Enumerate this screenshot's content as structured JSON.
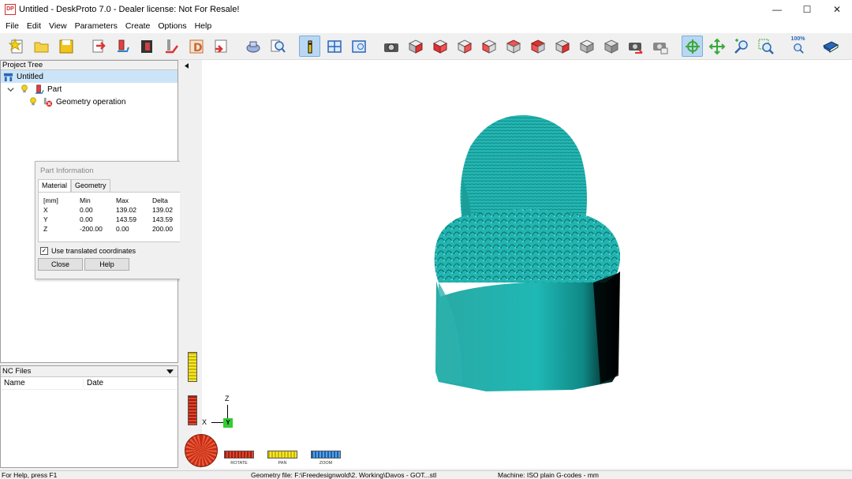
{
  "window": {
    "app_icon_text": "DP",
    "title": "Untitled - DeskProto 7.0 - Dealer license: Not For Resale!",
    "minimize": "—",
    "maximize": "☐",
    "close": "✕"
  },
  "menu": [
    "File",
    "Edit",
    "View",
    "Parameters",
    "Create",
    "Options",
    "Help"
  ],
  "toolbar": {
    "zoom_label": "100%"
  },
  "project_tree": {
    "header": "Project Tree",
    "root": "Untitled",
    "part": "Part",
    "operation": "Geometry operation"
  },
  "nc_files": {
    "header": "NC Files",
    "columns": [
      "Name",
      "Date"
    ]
  },
  "part_info": {
    "title": "Part Information",
    "tabs": [
      "Material",
      "Geometry"
    ],
    "headers": [
      "[mm]",
      "Min",
      "Max",
      "Delta"
    ],
    "rows": [
      [
        "X",
        "0.00",
        "139.02",
        "139.02"
      ],
      [
        "Y",
        "0.00",
        "143.59",
        "143.59"
      ],
      [
        "Z",
        "-200.00",
        "0.00",
        "200.00"
      ]
    ],
    "checkbox_label": "Use translated coordinates",
    "checkbox_checked": true,
    "check_mark": "✓",
    "close_label": "Close",
    "help_label": "Help"
  },
  "axes": {
    "z": "Z",
    "x": "X",
    "y": "Y"
  },
  "nav": {
    "rotate": "ROTATE",
    "pan": "PAN",
    "zoom": "ZOOM"
  },
  "status": {
    "help": "For Help, press F1",
    "geometry_file": "Geometry file: F:\\Freedesignwold\\2. Working\\Davos - GOT...stl",
    "machine": "Machine: ISO plain G-codes - mm"
  },
  "colors": {
    "model": "#1fb3b0",
    "selection": "#cce4f7",
    "toolbar_active": "#b9d7f2"
  }
}
